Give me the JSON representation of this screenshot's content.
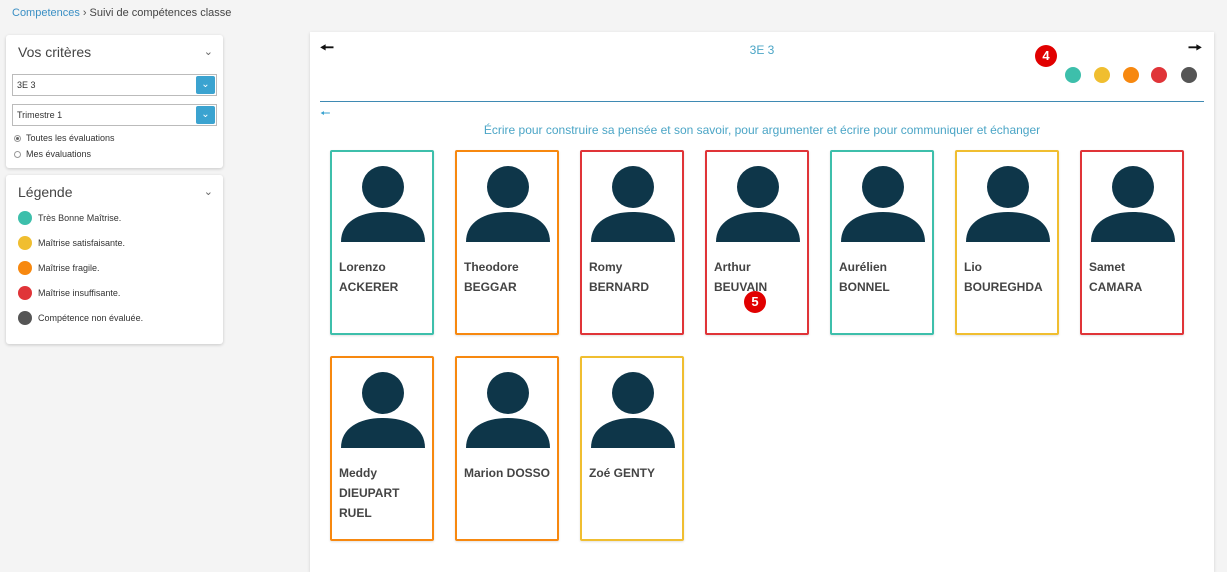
{
  "breadcrumb": {
    "link": "Competences",
    "current": "Suivi de compétences classe"
  },
  "criteres": {
    "title": "Vos critères",
    "class_select": "3E 3",
    "period_select": "Trimestre 1",
    "radio_all": "Toutes les évaluations",
    "radio_mine": "Mes évaluations"
  },
  "legende": {
    "title": "Légende",
    "items": [
      {
        "label": "Très Bonne Maîtrise.",
        "color": "#3dbfab"
      },
      {
        "label": "Maîtrise satisfaisante.",
        "color": "#f0be30"
      },
      {
        "label": "Maîtrise fragile.",
        "color": "#f7880f"
      },
      {
        "label": "Maîtrise insuffisante.",
        "color": "#e03438"
      },
      {
        "label": "Compétence non évaluée.",
        "color": "#555555"
      }
    ]
  },
  "main": {
    "class_title": "3E 3",
    "badge_filter": "4",
    "badge_card": "5",
    "competence": "Écrire pour construire sa pensée et son savoir, pour argumenter et écrire pour communiquer et échanger",
    "filter_colors": [
      "#3dbfab",
      "#f0be30",
      "#f7880f",
      "#e03438",
      "#555555"
    ]
  },
  "students": [
    {
      "line1": "Lorenzo",
      "line2": "ACKERER",
      "color": "#3dbfab"
    },
    {
      "line1": "Theodore",
      "line2": "BEGGAR",
      "color": "#f7880f"
    },
    {
      "line1": "Romy",
      "line2": "BERNARD",
      "color": "#e03438"
    },
    {
      "line1": "Arthur BEUVAIN",
      "line2": "",
      "color": "#e03438"
    },
    {
      "line1": "Aurélien",
      "line2": "BONNEL",
      "color": "#3dbfab"
    },
    {
      "line1": "Lio",
      "line2": "BOUREGHDA",
      "color": "#f0be30"
    },
    {
      "line1": "Samet",
      "line2": "CAMARA",
      "color": "#e03438"
    },
    {
      "line1": "Meddy",
      "line2": "DIEUPART RUEL",
      "color": "#f7880f"
    },
    {
      "line1": "Marion DOSSO",
      "line2": "",
      "color": "#f7880f"
    },
    {
      "line1": "Zoé GENTY",
      "line2": "",
      "color": "#f0be30"
    }
  ]
}
